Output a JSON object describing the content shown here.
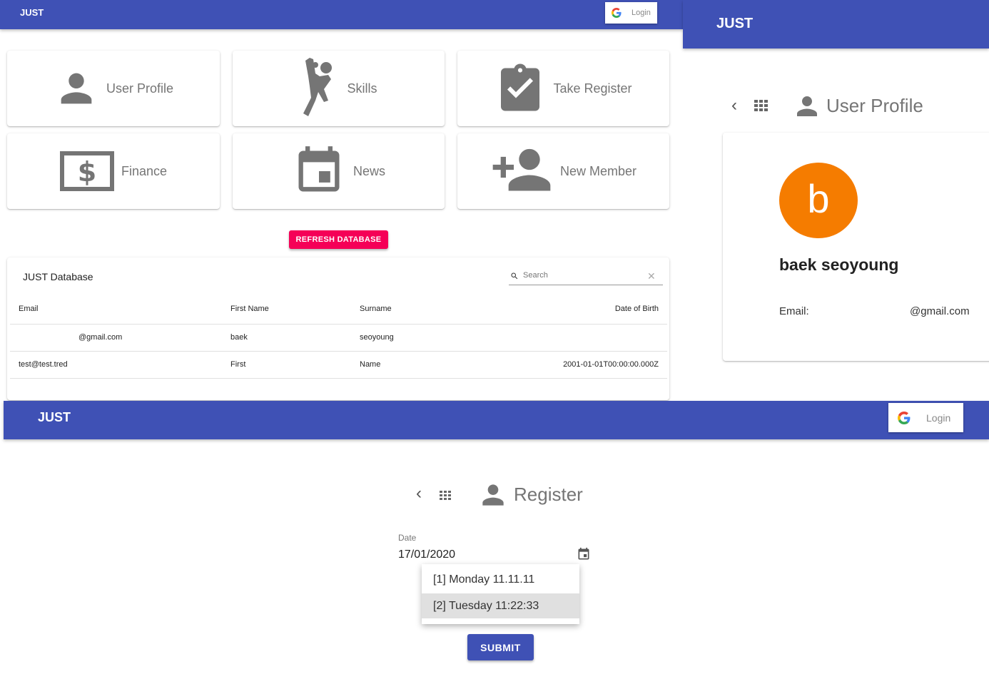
{
  "app_name": "JUST",
  "login_label": "Login",
  "colors": {
    "primary": "#3f51b5",
    "accent": "#f50057",
    "avatar": "#f57c00"
  },
  "dashboard": {
    "tiles": [
      {
        "label": "User Profile",
        "icon": "person-icon"
      },
      {
        "label": "Skills",
        "icon": "handball-icon"
      },
      {
        "label": "Take Register",
        "icon": "clipboard-check-icon"
      },
      {
        "label": "Finance",
        "icon": "money-icon"
      },
      {
        "label": "News",
        "icon": "calendar-event-icon"
      },
      {
        "label": "New Member",
        "icon": "person-add-icon"
      }
    ],
    "refresh_button": "REFRESH DATABASE",
    "table": {
      "title": "JUST Database",
      "search_placeholder": "Search",
      "headers": [
        "Email",
        "First Name",
        "Surname",
        "Date of Birth"
      ],
      "rows": [
        {
          "email": "@gmail.com",
          "first_name": "baek",
          "surname": "seoyoung",
          "dob": ""
        },
        {
          "email": "test@test.tred",
          "first_name": "First",
          "surname": "Name",
          "dob": "2001-01-01T00:00:00.000Z"
        }
      ]
    }
  },
  "profile": {
    "title": "User Profile",
    "avatar_letter": "b",
    "name": "baek seoyoung",
    "email_label": "Email:",
    "email_value": "@gmail.com"
  },
  "register": {
    "title": "Register",
    "date_label": "Date",
    "date_value": "17/01/2020",
    "options": [
      "[1] Monday 11.11.11",
      "[2] Tuesday 11:22:33"
    ],
    "selected_index": 1,
    "submit": "SUBMIT"
  }
}
